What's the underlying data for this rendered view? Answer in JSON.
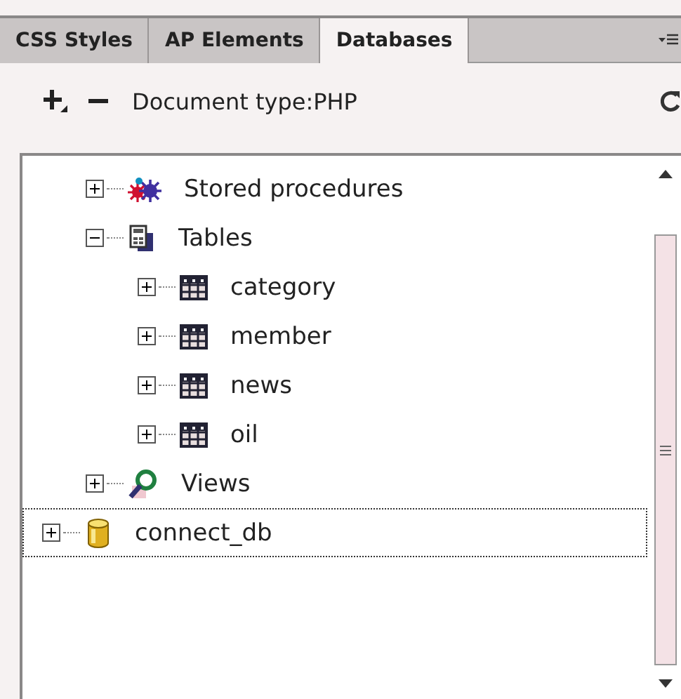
{
  "tabs": [
    {
      "label": "CSS Styles",
      "selected": false
    },
    {
      "label": "AP Elements",
      "selected": false
    },
    {
      "label": "Databases",
      "selected": true
    }
  ],
  "toolbar": {
    "document_type": "Document type:PHP"
  },
  "tree": [
    {
      "children": [
        {
          "label": "Stored procedures",
          "kind": "procedures",
          "expanded": false,
          "selected": false
        },
        {
          "label": "Tables",
          "kind": "tables",
          "expanded": true,
          "selected": false,
          "children": [
            {
              "label": "category",
              "kind": "table",
              "expanded": false,
              "selected": false
            },
            {
              "label": "member",
              "kind": "table",
              "expanded": false,
              "selected": false
            },
            {
              "label": "news",
              "kind": "table",
              "expanded": false,
              "selected": false
            },
            {
              "label": "oil",
              "kind": "table",
              "expanded": false,
              "selected": false
            }
          ]
        },
        {
          "label": "Views",
          "kind": "views",
          "expanded": false,
          "selected": false
        }
      ]
    },
    {
      "label": "connect_db",
      "kind": "database",
      "expanded": false,
      "selected": true
    }
  ]
}
